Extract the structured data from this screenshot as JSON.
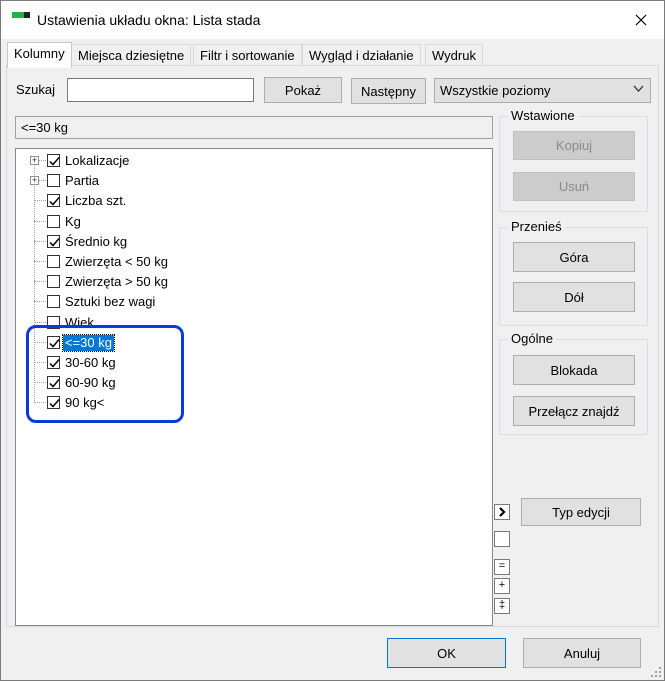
{
  "window": {
    "title": "Ustawienia układu okna: Lista stada",
    "close_symbol": "✕"
  },
  "tabs": [
    {
      "label": "Kolumny",
      "active": true
    },
    {
      "label": "Miejsca dziesiętne",
      "active": false
    },
    {
      "label": "Filtr i sortowanie",
      "active": false
    },
    {
      "label": "Wygląd i działanie",
      "active": false
    },
    {
      "label": "Wydruk",
      "active": false
    }
  ],
  "search": {
    "label": "Szukaj",
    "value": "",
    "show_button": "Pokaż",
    "next_button": "Następny",
    "level_select": "Wszystkie poziomy"
  },
  "filter_text": "<=30 kg",
  "tree": [
    {
      "label": "Lokalizacje",
      "checked": true,
      "expandable": true
    },
    {
      "label": "Partia",
      "checked": false,
      "expandable": true
    },
    {
      "label": "Liczba szt.",
      "checked": true,
      "expandable": false
    },
    {
      "label": "Kg",
      "checked": false,
      "expandable": false
    },
    {
      "label": "Średnio kg",
      "checked": true,
      "expandable": false
    },
    {
      "label": "Zwierzęta < 50 kg",
      "checked": false,
      "expandable": false
    },
    {
      "label": "Zwierzęta > 50 kg",
      "checked": false,
      "expandable": false
    },
    {
      "label": "Sztuki bez wagi",
      "checked": false,
      "expandable": false
    },
    {
      "label": "Wiek",
      "checked": false,
      "expandable": false
    },
    {
      "label": "<=30 kg",
      "checked": true,
      "expandable": false,
      "selected": true
    },
    {
      "label": "30-60 kg",
      "checked": true,
      "expandable": false
    },
    {
      "label": "60-90 kg",
      "checked": true,
      "expandable": false
    },
    {
      "label": "90 kg<",
      "checked": true,
      "expandable": false
    }
  ],
  "groups": {
    "inserted": {
      "title": "Wstawione",
      "copy_button": "Kopiuj",
      "delete_button": "Usuń"
    },
    "move": {
      "title": "Przenieś",
      "up_button": "Góra",
      "down_button": "Dół"
    },
    "general": {
      "title": "Ogólne",
      "lock_button": "Blokada",
      "toggle_find_button": "Przełącz znajdź"
    }
  },
  "side_buttons": {
    "arrow": "›",
    "equals": "=",
    "plus": "+",
    "dagger": "‡"
  },
  "edit_type_button": "Typ edycji",
  "footer": {
    "ok": "OK",
    "cancel": "Anuluj"
  },
  "colors": {
    "selection": "#0078d7",
    "highlight_ring": "#0a3adc",
    "checkmark": "#000000"
  }
}
